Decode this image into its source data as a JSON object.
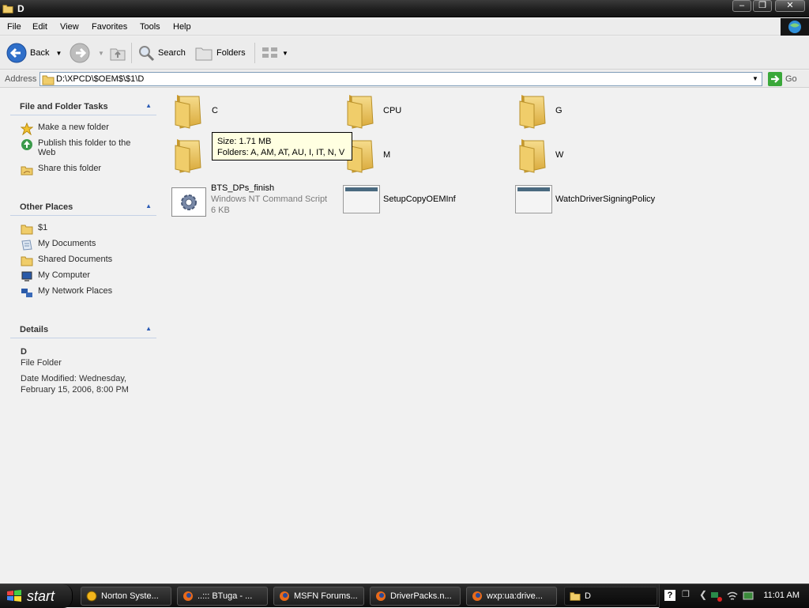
{
  "window": {
    "title": "D"
  },
  "menu": [
    "File",
    "Edit",
    "View",
    "Favorites",
    "Tools",
    "Help"
  ],
  "toolbar": {
    "back": "Back",
    "search": "Search",
    "folders": "Folders"
  },
  "address": {
    "label": "Address",
    "value": "D:\\XPCD\\$OEM$\\$1\\D",
    "go": "Go"
  },
  "left": {
    "tasks_title": "File and Folder Tasks",
    "tasks": [
      "Make a new folder",
      "Publish this folder to the Web",
      "Share this folder"
    ],
    "places_title": "Other Places",
    "places": [
      "$1",
      "My Documents",
      "Shared Documents",
      "My Computer",
      "My Network Places"
    ],
    "details_title": "Details",
    "details_name": "D",
    "details_type": "File Folder",
    "details_modified": "Date Modified: Wednesday, February 15, 2006, 8:00 PM"
  },
  "files": {
    "c": "C",
    "cpu": "CPU",
    "g": "G",
    "m": "M",
    "w": "W",
    "bts_name": "BTS_DPs_finish",
    "bts_type": "Windows NT Command Script",
    "bts_size": "6 KB",
    "setup": "SetupCopyOEMInf",
    "watch": "WatchDriverSigningPolicy"
  },
  "tooltip": {
    "line1": "Size: 1.71 MB",
    "line2": "Folders: A, AM, AT, AU, I, IT, N, V"
  },
  "taskbar": {
    "start": "start",
    "tasks": [
      "Norton Syste...",
      "..::: BTuga - ...",
      "MSFN Forums...",
      "DriverPacks.n...",
      "wxp:ua:drive...",
      "D"
    ],
    "clock": "11:01 AM"
  },
  "colors": {
    "link": "#2b5bb5",
    "folder": "#e8c464",
    "tooltip_bg": "#ffffe1"
  }
}
